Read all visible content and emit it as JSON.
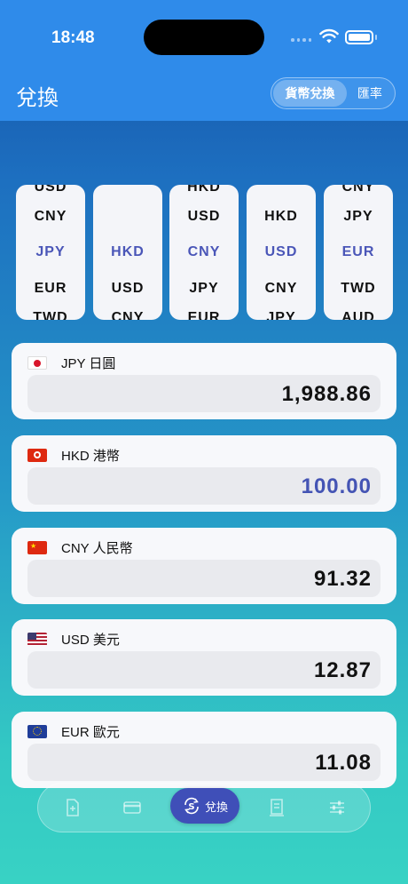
{
  "status": {
    "time": "18:48"
  },
  "header": {
    "title": "兌換",
    "segments": [
      {
        "label": "貨幣兌換",
        "active": true
      },
      {
        "label": "匯率",
        "active": false
      }
    ]
  },
  "pickers": [
    {
      "rows": [
        "USD",
        "CNY",
        "JPY",
        "EUR",
        "TWD"
      ],
      "selected": "JPY"
    },
    {
      "rows": [
        "",
        "",
        "HKD",
        "USD",
        "CNY"
      ],
      "selected": "HKD"
    },
    {
      "rows": [
        "HKD",
        "USD",
        "CNY",
        "JPY",
        "EUR"
      ],
      "selected": "CNY"
    },
    {
      "rows": [
        "",
        "HKD",
        "USD",
        "CNY",
        "JPY"
      ],
      "selected": "USD"
    },
    {
      "rows": [
        "CNY",
        "JPY",
        "EUR",
        "TWD",
        "AUD"
      ],
      "selected": "EUR"
    }
  ],
  "currencies": [
    {
      "code_label": "JPY 日圓",
      "amount": "1,988.86",
      "flag": "jp",
      "active": false
    },
    {
      "code_label": "HKD 港幣",
      "amount": "100.00",
      "flag": "hk",
      "active": true
    },
    {
      "code_label": "CNY 人民幣",
      "amount": "91.32",
      "flag": "cn",
      "active": false
    },
    {
      "code_label": "USD 美元",
      "amount": "12.87",
      "flag": "us",
      "active": false
    },
    {
      "code_label": "EUR 歐元",
      "amount": "11.08",
      "flag": "eu",
      "active": false
    }
  ],
  "tabbar": {
    "items": [
      "document-plus-icon",
      "credit-card-icon",
      "currency-exchange-icon",
      "receipt-icon",
      "sliders-icon"
    ],
    "active_label": "兌換"
  },
  "colors": {
    "accent": "#4454b4",
    "header": "#2f8bea"
  }
}
